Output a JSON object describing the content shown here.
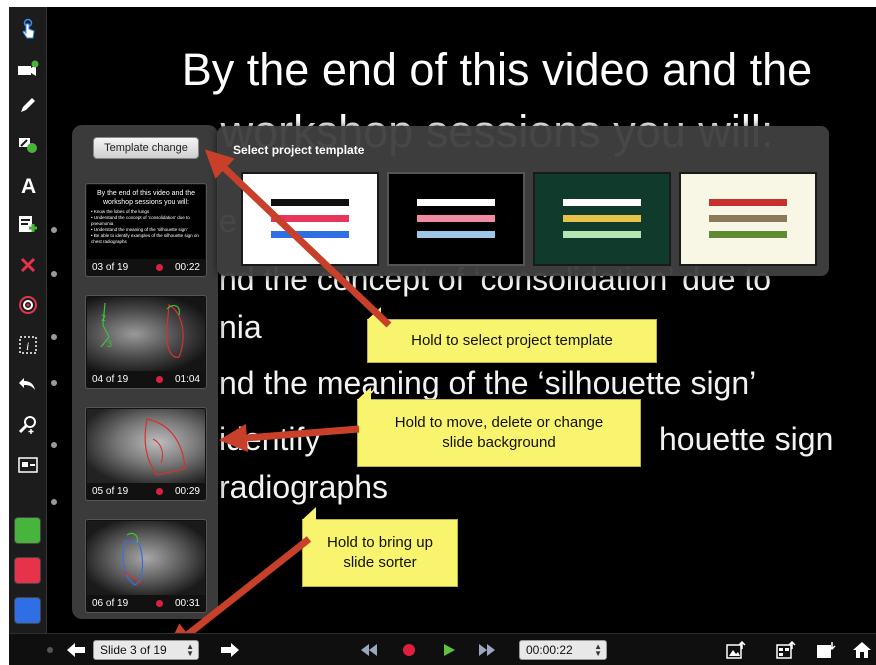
{
  "slide": {
    "title_line1": "By the end of this video and the",
    "title_line2": "workshop sessions you will:",
    "bullet_fragment_1": "e",
    "bullet_line_2": "nd the concept of ‘consolidation’ due to",
    "bullet_line_3": "nia",
    "bullet_line_4": "nd the meaning of the ‘silhouette sign’",
    "bullet_line_5a": "identify",
    "bullet_line_5b": "houette sign",
    "bullet_line_6": "radiographs"
  },
  "toolbar": {
    "colors": [
      "#47b43c",
      "#e6334a",
      "#2f6fe6"
    ]
  },
  "template_popup": {
    "title": "Select project template",
    "change_button": "Template change",
    "templates": [
      {
        "bg": "#ffffff",
        "lines": [
          "#111111",
          "#e8365a",
          "#2f6fe6"
        ]
      },
      {
        "bg": "#000000",
        "lines": [
          "#ffffff",
          "#f08aa3",
          "#9cc7e6"
        ]
      },
      {
        "bg": "#0f3a2c",
        "lines": [
          "#ffffff",
          "#e8c14a",
          "#b6e5b2"
        ]
      },
      {
        "bg": "#f8f6e4",
        "lines": [
          "#c8302c",
          "#8a7a5a",
          "#5e8b32"
        ]
      }
    ]
  },
  "sorter": {
    "thumb1_title": "By the end of this video and the workshop sessions you will:",
    "thumb1_bullets": [
      "• Know the lobes of the lungs",
      "• Understand the concept of ‘consolidation’ due to pneumonia",
      "• Understand the meaning of the ‘silhouette sign’",
      "• Be able to identify examples of the silhouette sign on chest radiographs"
    ],
    "slides": [
      {
        "num": "03 of 19",
        "time": "00:22"
      },
      {
        "num": "04 of 19",
        "time": "01:04"
      },
      {
        "num": "05 of 19",
        "time": "00:29"
      },
      {
        "num": "06 of 19",
        "time": "00:31"
      }
    ]
  },
  "callouts": {
    "template": "Hold to select project template",
    "move_line1": "Hold to move, delete or change",
    "move_line2": "slide background",
    "sorter_line1": "Hold to bring up",
    "sorter_line2": "slide sorter"
  },
  "bottombar": {
    "slide_selector": "Slide 3 of 19",
    "timer": "00:00:22"
  }
}
